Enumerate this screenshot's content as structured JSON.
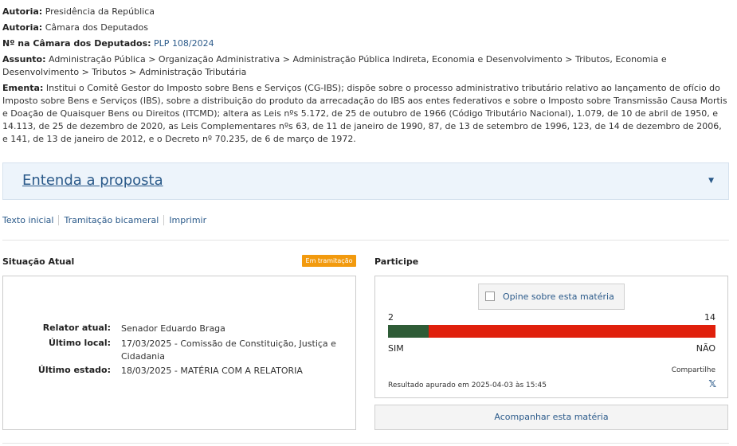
{
  "meta": {
    "autoria1_label": "Autoria:",
    "autoria1_value": "Presidência da República",
    "autoria2_label": "Autoria:",
    "autoria2_value": "Câmara dos Deputados",
    "camara_label": "Nº na Câmara dos Deputados:",
    "camara_value": "PLP 108/2024",
    "assunto_label": "Assunto:",
    "assunto_value": "Administração Pública > Organização Administrativa > Administração Pública Indireta, Economia e Desenvolvimento > Tributos, Economia e Desenvolvimento > Tributos > Administração Tributária",
    "ementa_label": "Ementa:",
    "ementa_value": "Institui o Comitê Gestor do Imposto sobre Bens e Serviços (CG-IBS); dispõe sobre o processo administrativo tributário relativo ao lançamento de ofício do Imposto sobre Bens e Serviços (IBS), sobre a distribuição do produto da arrecadação do IBS aos entes federativos e sobre o Imposto sobre Transmissão Causa Mortis e Doação de Quaisquer Bens ou Direitos (ITCMD); altera as Leis nºs 5.172, de 25 de outubro de 1966 (Código Tributário Nacional), 1.079, de 10 de abril de 1950, e 14.113, de 25 de dezembro de 2020, as Leis Complementares nºs 63, de 11 de janeiro de 1990, 87, de 13 de setembro de 1996, 123, de 14 de dezembro de 2006, e 141, de 13 de janeiro de 2012, e o Decreto nº 70.235, de 6 de março de 1972."
  },
  "accordion": {
    "title": "Entenda a proposta",
    "icon": "caret-down-icon"
  },
  "links": {
    "texto_inicial": "Texto inicial",
    "tramitacao": "Tramitação bicameral",
    "imprimir": "Imprimir"
  },
  "situacao": {
    "title": "Situação Atual",
    "badge": "Em tramitação",
    "relator_label": "Relator atual:",
    "relator_value": "Senador Eduardo Braga",
    "local_label": "Último local:",
    "local_value": "17/03/2025 - Comissão de Constituição, Justiça e Cidadania",
    "estado_label": "Último estado:",
    "estado_value": "18/03/2025 - MATÉRIA COM A RELATORIA"
  },
  "participe": {
    "title": "Participe",
    "opine_label": "Opine sobre esta matéria",
    "yes_count": "2",
    "no_count": "14",
    "yes_label": "SIM",
    "no_label": "NÃO",
    "yes_color": "#2f5c37",
    "no_color": "#e0200c",
    "share_label": "Compartilhe",
    "share_facebook": "",
    "share_x": "𝕏",
    "result_label": "Resultado apurado em 2025-04-03 às 15:45",
    "acompanhar_label": "Acompanhar esta matéria",
    "acompanhar_icon": ""
  }
}
